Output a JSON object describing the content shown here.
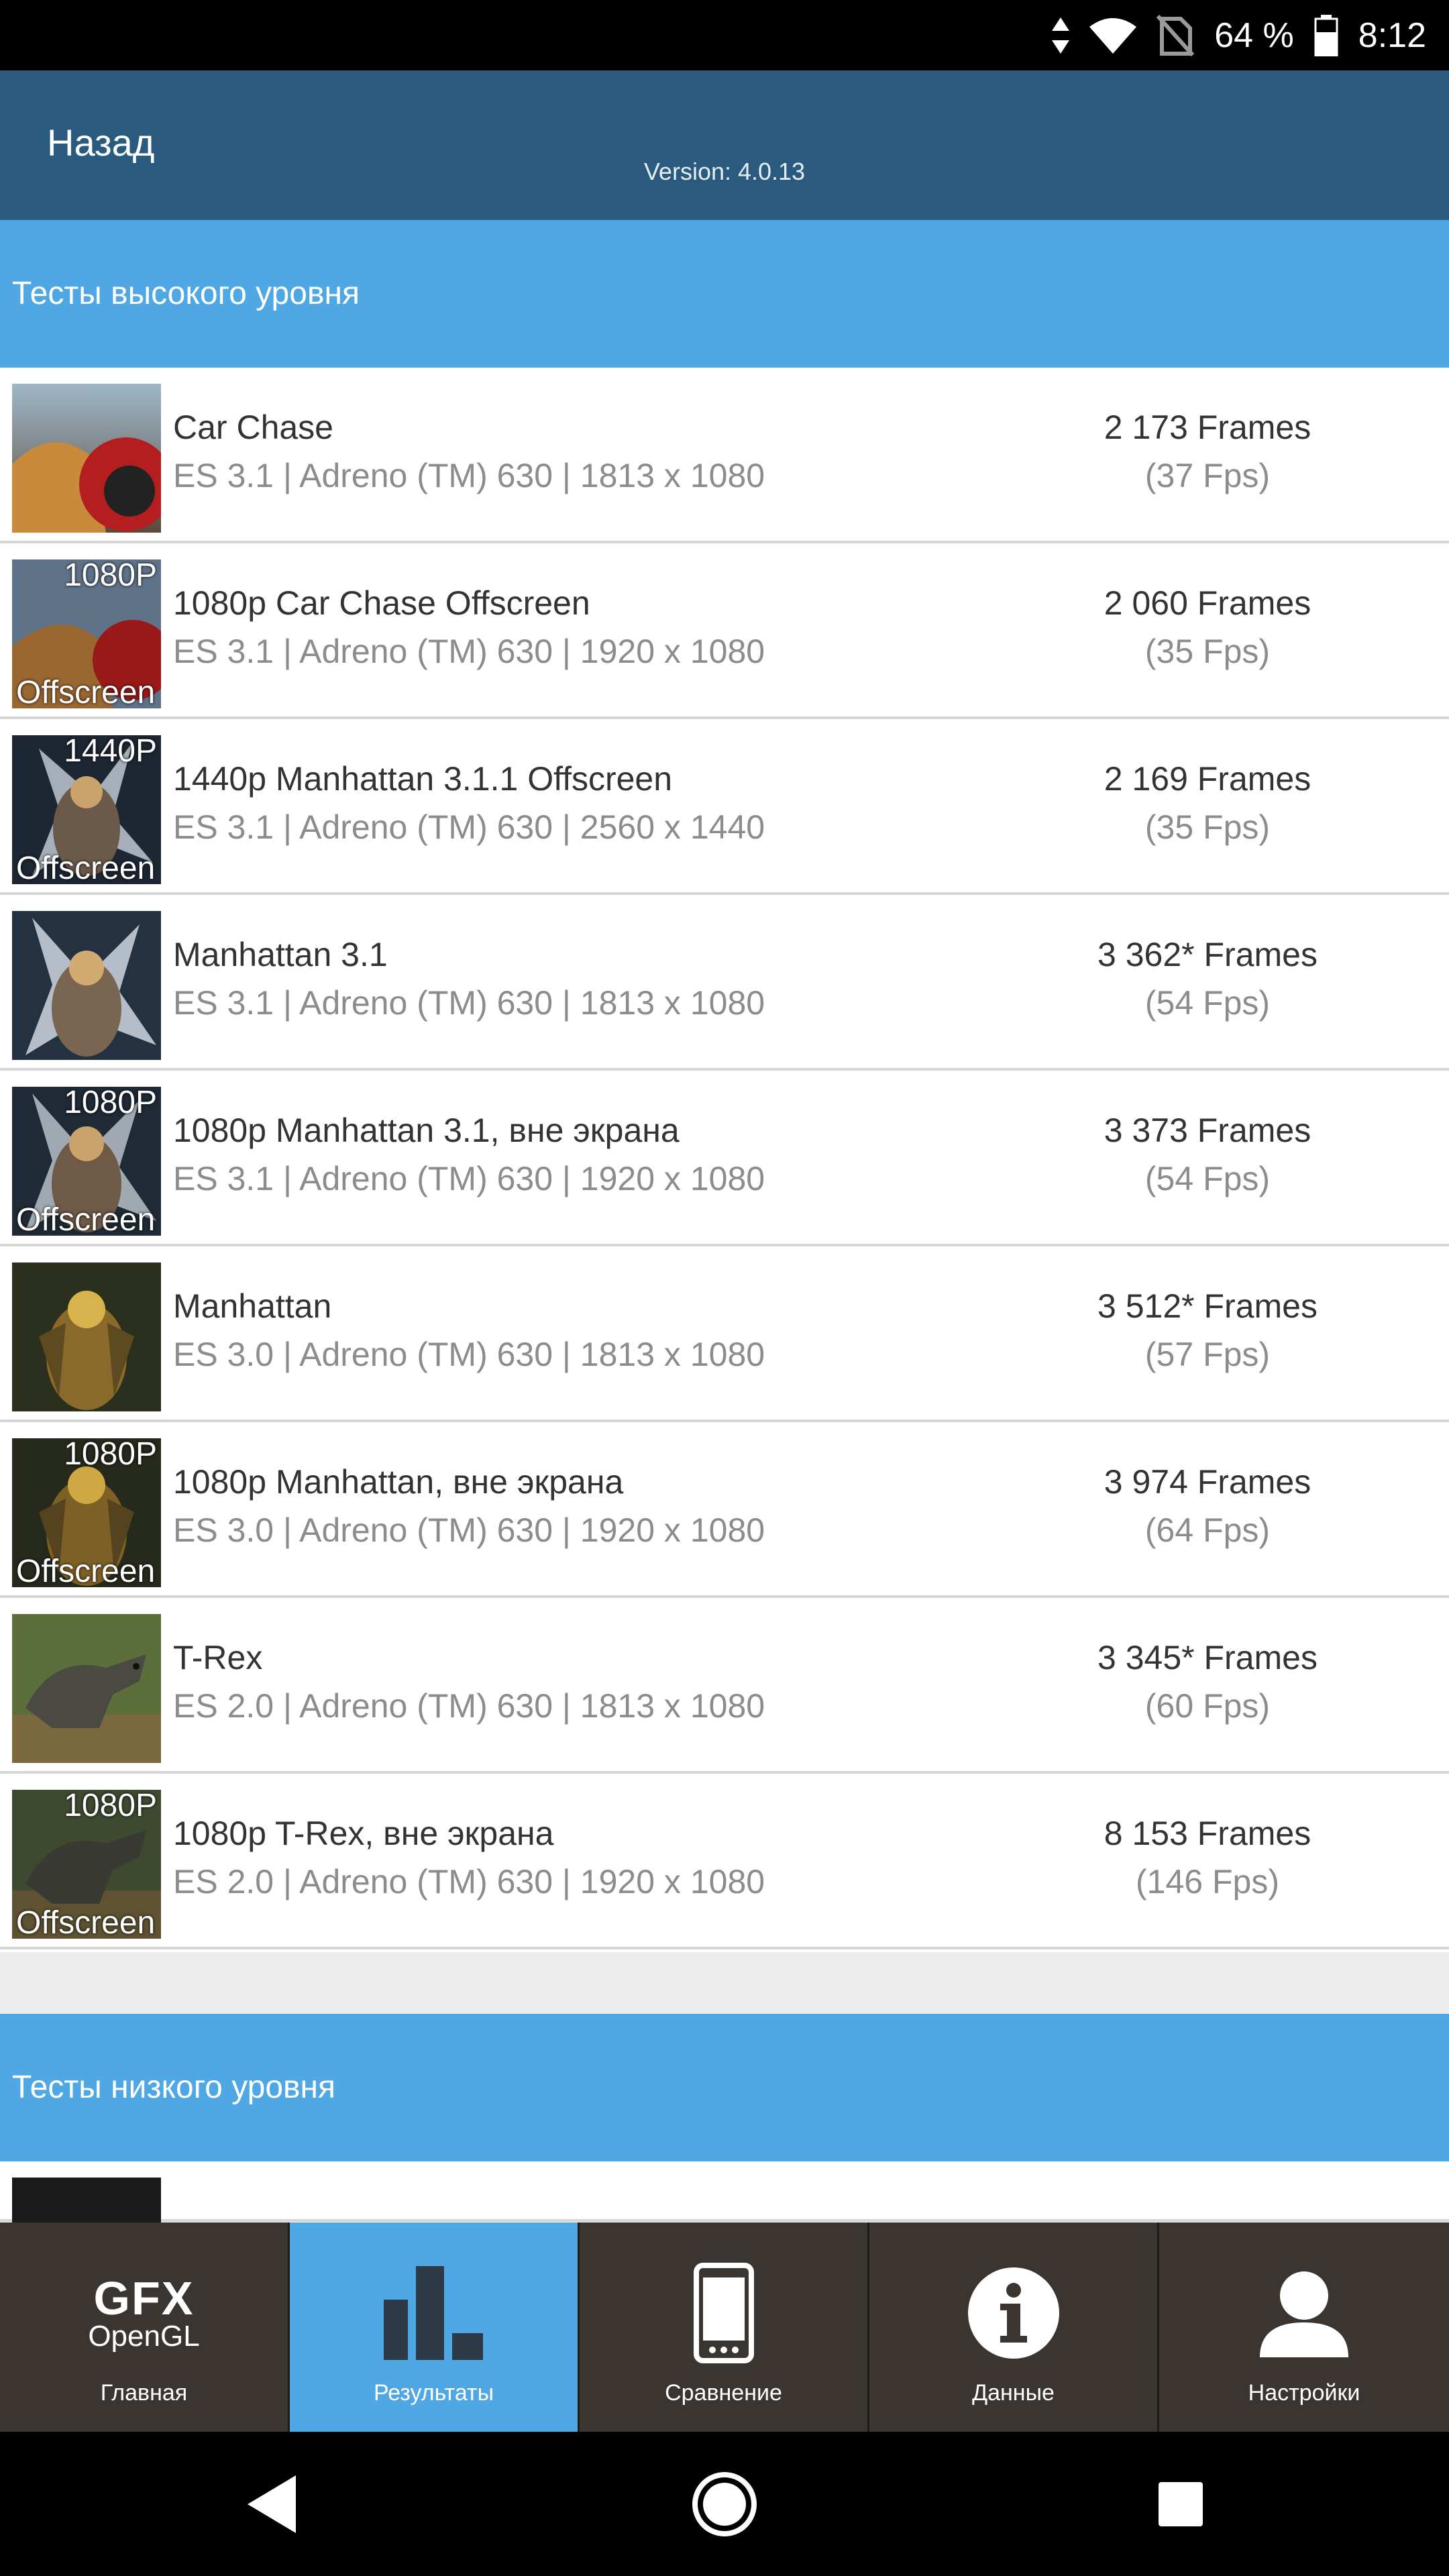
{
  "status_bar": {
    "battery": "64 %",
    "time": "8:12"
  },
  "header": {
    "back_label": "Назад",
    "version": "Version: 4.0.13"
  },
  "high_level": {
    "title": "Тесты высокого уровня",
    "rows": [
      {
        "title": "Car Chase",
        "subtitle": "ES 3.1 | Adreno (TM) 630 | 1813 x 1080",
        "score": "2 173 Frames",
        "fps": "(37 Fps)",
        "tag1": "",
        "tag2": ""
      },
      {
        "title": "1080p Car Chase Offscreen",
        "subtitle": "ES 3.1 | Adreno (TM) 630 | 1920 x 1080",
        "score": "2 060 Frames",
        "fps": "(35 Fps)",
        "tag1": "1080P",
        "tag2": "Offscreen"
      },
      {
        "title": "1440p Manhattan 3.1.1 Offscreen",
        "subtitle": "ES 3.1 | Adreno (TM) 630 | 2560 x 1440",
        "score": "2 169 Frames",
        "fps": "(35 Fps)",
        "tag1": "1440P",
        "tag2": "Offscreen"
      },
      {
        "title": "Manhattan 3.1",
        "subtitle": "ES 3.1 | Adreno (TM) 630 | 1813 x 1080",
        "score": "3 362* Frames",
        "fps": "(54 Fps)",
        "tag1": "",
        "tag2": ""
      },
      {
        "title": "1080p Manhattan 3.1, вне экрана",
        "subtitle": "ES 3.1 | Adreno (TM) 630 | 1920 x 1080",
        "score": "3 373 Frames",
        "fps": "(54 Fps)",
        "tag1": "1080P",
        "tag2": "Offscreen"
      },
      {
        "title": "Manhattan",
        "subtitle": "ES 3.0 | Adreno (TM) 630 | 1813 x 1080",
        "score": "3 512* Frames",
        "fps": "(57 Fps)",
        "tag1": "",
        "tag2": ""
      },
      {
        "title": "1080p Manhattan, вне экрана",
        "subtitle": "ES 3.0 | Adreno (TM) 630 | 1920 x 1080",
        "score": "3 974 Frames",
        "fps": "(64 Fps)",
        "tag1": "1080P",
        "tag2": "Offscreen"
      },
      {
        "title": "T-Rex",
        "subtitle": "ES 2.0 | Adreno (TM) 630 | 1813 x 1080",
        "score": "3 345* Frames",
        "fps": "(60 Fps)",
        "tag1": "",
        "tag2": ""
      },
      {
        "title": "1080p T-Rex, вне экрана",
        "subtitle": "ES 2.0 | Adreno (TM) 630 | 1920 x 1080",
        "score": "8 153 Frames",
        "fps": "(146 Fps)",
        "tag1": "1080P",
        "tag2": "Offscreen"
      }
    ]
  },
  "low_level": {
    "title": "Тесты низкого уровня"
  },
  "bottom_nav": {
    "gfx_line1": "GFX",
    "gfx_line2": "OpenGL",
    "tabs": [
      {
        "label": "Главная",
        "icon": "gfx-logo-icon",
        "active": false
      },
      {
        "label": "Результаты",
        "icon": "bar-chart-icon",
        "active": true
      },
      {
        "label": "Сравнение",
        "icon": "phone-icon",
        "active": false
      },
      {
        "label": "Данные",
        "icon": "info-icon",
        "active": false
      },
      {
        "label": "Настройки",
        "icon": "user-icon",
        "active": false
      }
    ]
  },
  "colors": {
    "header": "#2a5a7e",
    "section": "#4fa7e3",
    "nav": "#3b3531",
    "active_tab": "#4fa7e3"
  }
}
